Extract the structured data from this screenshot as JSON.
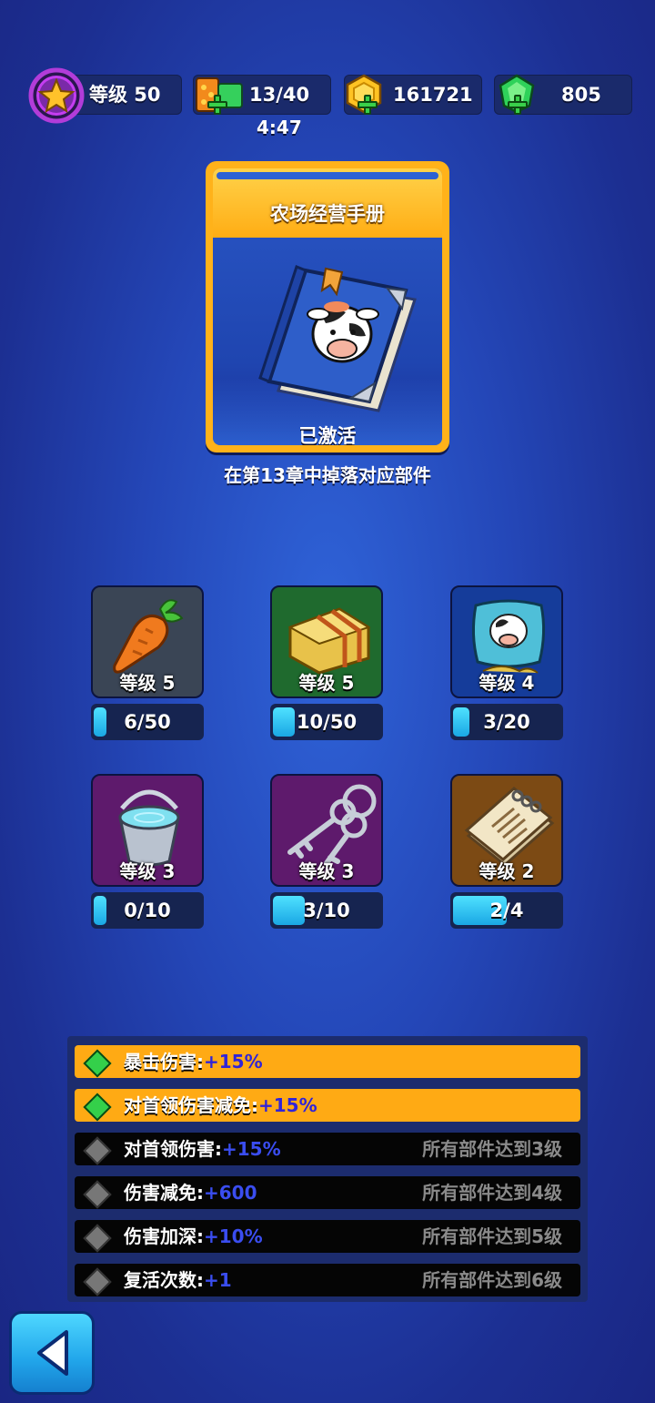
{
  "header": {
    "level": "等级 50",
    "energy": "13/40",
    "timer": "4:47",
    "coins": "161721",
    "gems": "805"
  },
  "book": {
    "title": "农场经营手册",
    "status": "已激活",
    "hint": "在第13章中掉落对应部件"
  },
  "parts": [
    {
      "name": "carrot",
      "level": "等级 5",
      "progress": "6/50",
      "fraction": 0.12,
      "tile_color": "#3a4555"
    },
    {
      "name": "hay-bale",
      "level": "等级 5",
      "progress": "10/50",
      "fraction": 0.2,
      "tile_color": "#1f6a2e"
    },
    {
      "name": "feed-sack",
      "level": "等级 4",
      "progress": "3/20",
      "fraction": 0.15,
      "tile_color": "#153c9a"
    },
    {
      "name": "bucket",
      "level": "等级 3",
      "progress": "0/10",
      "fraction": 0.0,
      "tile_color": "#5e1a6c"
    },
    {
      "name": "keys",
      "level": "等级 3",
      "progress": "3/10",
      "fraction": 0.3,
      "tile_color": "#5e1a6c"
    },
    {
      "name": "notepad",
      "level": "等级 2",
      "progress": "2/4",
      "fraction": 0.5,
      "tile_color": "#7c4a14"
    }
  ],
  "bonuses": [
    {
      "label": "暴击伤害:",
      "value": "+15%",
      "active": true,
      "requirement": ""
    },
    {
      "label": "对首领伤害减免:",
      "value": "+15%",
      "active": true,
      "requirement": ""
    },
    {
      "label": "对首领伤害:",
      "value": "+15%",
      "active": false,
      "requirement": "所有部件达到3级"
    },
    {
      "label": "伤害减免:",
      "value": "+600",
      "active": false,
      "requirement": "所有部件达到4级"
    },
    {
      "label": "伤害加深:",
      "value": "+10%",
      "active": false,
      "requirement": "所有部件达到5级"
    },
    {
      "label": "复活次数:",
      "value": "+1",
      "active": false,
      "requirement": "所有部件达到6级"
    }
  ],
  "colors": {
    "gold": "#ffb21a",
    "active_row": "#ffaa14",
    "progress_fill": "#1aa7e4"
  }
}
